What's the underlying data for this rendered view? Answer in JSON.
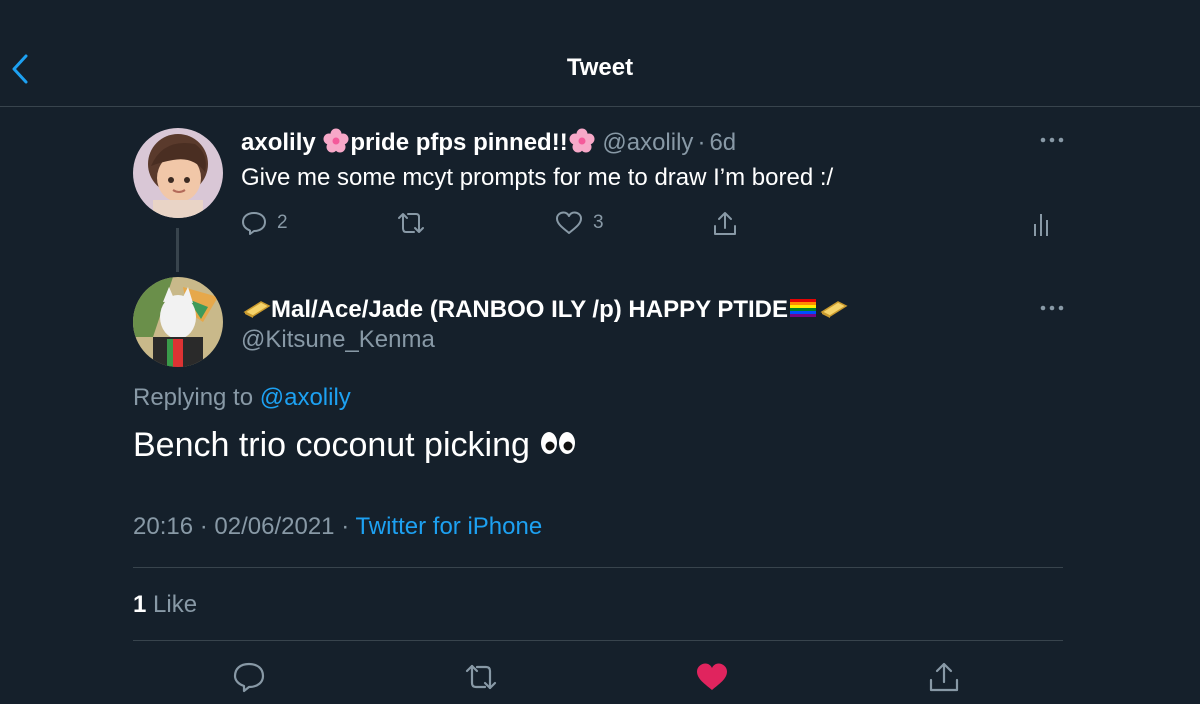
{
  "header": {
    "title": "Tweet"
  },
  "parent_tweet": {
    "display_name_part1": "axolily",
    "display_name_part2": "pride pfps pinned!!",
    "handle": "@axolily",
    "separator": "·",
    "time": "6d",
    "text": "Give me some mcyt prompts for me to draw I’m bored :/",
    "reply_count": "2",
    "like_count": "3"
  },
  "main_tweet": {
    "display_name": "Mal/Ace/Jade (RANBOO ILY /p) HAPPY PTIDE",
    "handle": "@Kitsune_Kenma",
    "replying_label": "Replying to",
    "replying_handle": "@axolily",
    "text": "Bench trio coconut picking",
    "time": "20:16",
    "dot1": "·",
    "date": "02/06/2021",
    "dot2": "·",
    "source": "Twitter for iPhone",
    "like_count": "1",
    "like_label": "Like"
  },
  "colors": {
    "background": "#15202b",
    "accent": "#1da1f2",
    "muted": "#8899a6",
    "like": "#e0245e",
    "divider": "#38444d"
  },
  "icons": {
    "back": "chevron-left-icon",
    "reply": "speech-bubble-icon",
    "retweet": "retweet-icon",
    "like": "heart-icon",
    "share": "share-icon",
    "analytics": "analytics-icon",
    "more": "ellipsis-icon",
    "emoji_flower": "cherry-blossom-emoji",
    "emoji_bar": "gold-bar-emoji",
    "emoji_flag": "rainbow-flag-emoji",
    "emoji_eyes": "eyes-emoji"
  }
}
